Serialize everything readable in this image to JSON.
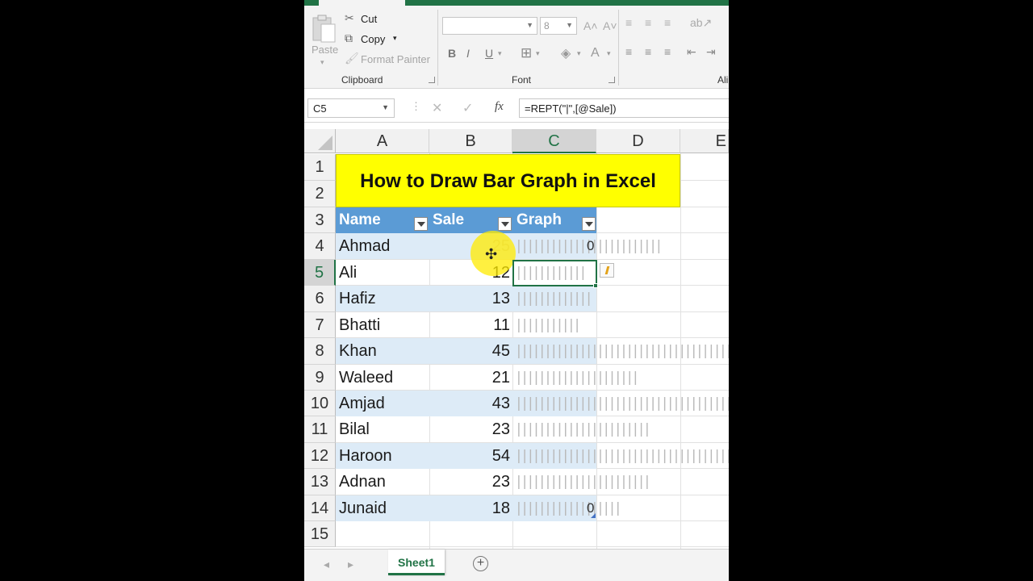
{
  "ribbon": {
    "clipboard": {
      "paste": "Paste",
      "cut": "Cut",
      "copy": "Copy",
      "format_painter": "Format Painter",
      "group": "Clipboard"
    },
    "font": {
      "font_name": "",
      "font_size": "8",
      "group": "Font"
    },
    "alignment": {
      "group": "Ali"
    }
  },
  "formula_bar": {
    "name_box": "C5",
    "fx": "fx",
    "formula": "=REPT(\"|\",[@Sale])"
  },
  "columns": [
    "A",
    "B",
    "C",
    "D",
    "E"
  ],
  "rows": [
    "1",
    "2",
    "3",
    "4",
    "5",
    "6",
    "7",
    "8",
    "9",
    "10",
    "11",
    "12",
    "13",
    "14",
    "15"
  ],
  "title": "How to Draw Bar Graph in Excel",
  "table": {
    "headers": [
      "Name",
      "Sale",
      "Graph"
    ],
    "records": [
      {
        "name": "Ahmad",
        "sale": "25",
        "bars": 25,
        "zero": "0"
      },
      {
        "name": "Ali",
        "sale": "12",
        "bars": 12,
        "zero": ""
      },
      {
        "name": "Hafiz",
        "sale": "13",
        "bars": 13,
        "zero": ""
      },
      {
        "name": "Bhatti",
        "sale": "11",
        "bars": 11,
        "zero": ""
      },
      {
        "name": "Khan",
        "sale": "45",
        "bars": 45,
        "zero": ""
      },
      {
        "name": "Waleed",
        "sale": "21",
        "bars": 21,
        "zero": ""
      },
      {
        "name": "Amjad",
        "sale": "43",
        "bars": 43,
        "zero": ""
      },
      {
        "name": "Bilal",
        "sale": "23",
        "bars": 23,
        "zero": ""
      },
      {
        "name": "Haroon",
        "sale": "54",
        "bars": 54,
        "zero": ""
      },
      {
        "name": "Adnan",
        "sale": "23",
        "bars": 23,
        "zero": ""
      },
      {
        "name": "Junaid",
        "sale": "18",
        "bars": 18,
        "zero": "0"
      }
    ]
  },
  "sheet_tabs": [
    "Sheet1"
  ],
  "colors": {
    "excel_green": "#217346",
    "table_header": "#5b9bd5",
    "band": "#ddebf7",
    "title_fill": "#ffff00"
  }
}
